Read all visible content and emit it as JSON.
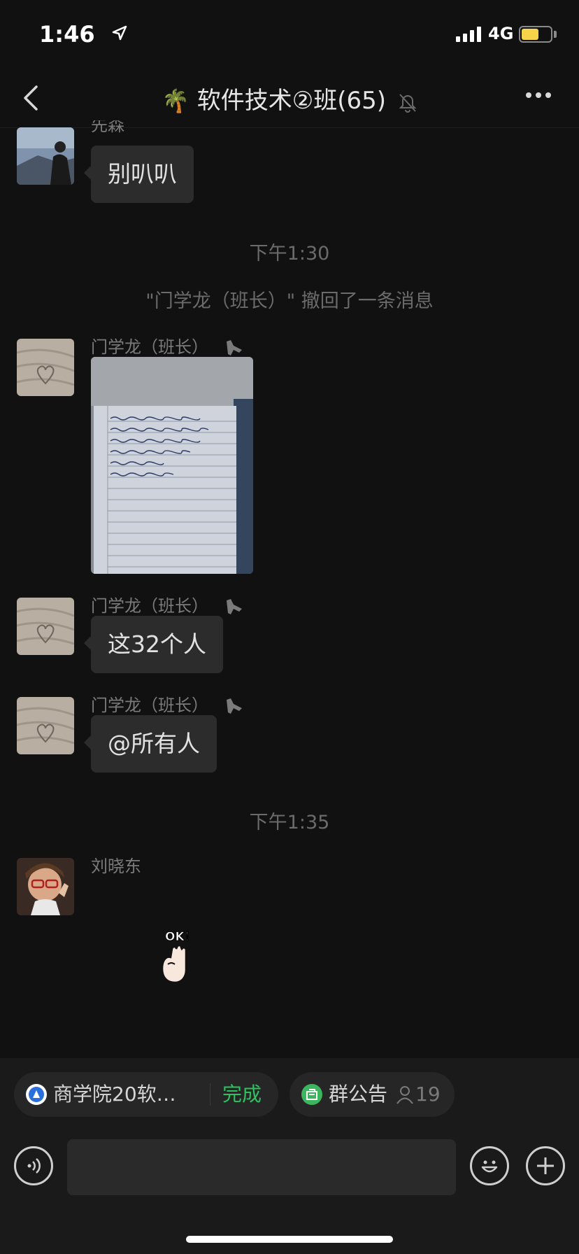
{
  "status": {
    "time": "1:46",
    "network": "4G",
    "battery_level": 0.6
  },
  "nav": {
    "title": "软件技术②班",
    "count": "(65)",
    "emoji": "🌴"
  },
  "messages": [
    {
      "sender": "先森",
      "text": "别叭叭"
    },
    {
      "timestamp": "下午1:30"
    },
    {
      "system": "\"门学龙（班长）\" 撤回了一条消息"
    },
    {
      "sender": "门学龙（班长）",
      "type": "image"
    },
    {
      "sender": "门学龙（班长）",
      "text": "这32个人"
    },
    {
      "sender": "门学龙（班长）",
      "text": "@所有人"
    },
    {
      "timestamp": "下午1:35"
    },
    {
      "sender": "刘晓东",
      "type": "sticker",
      "sticker_text": "OK！"
    }
  ],
  "quickbar": {
    "chip1_label": "商学院20软…",
    "chip1_action": "完成",
    "chip2_label": "群公告",
    "chip2_count": "19"
  },
  "colors": {
    "accent_green": "#2dc160",
    "background": "#111111",
    "bubble": "#2c2c2c"
  }
}
